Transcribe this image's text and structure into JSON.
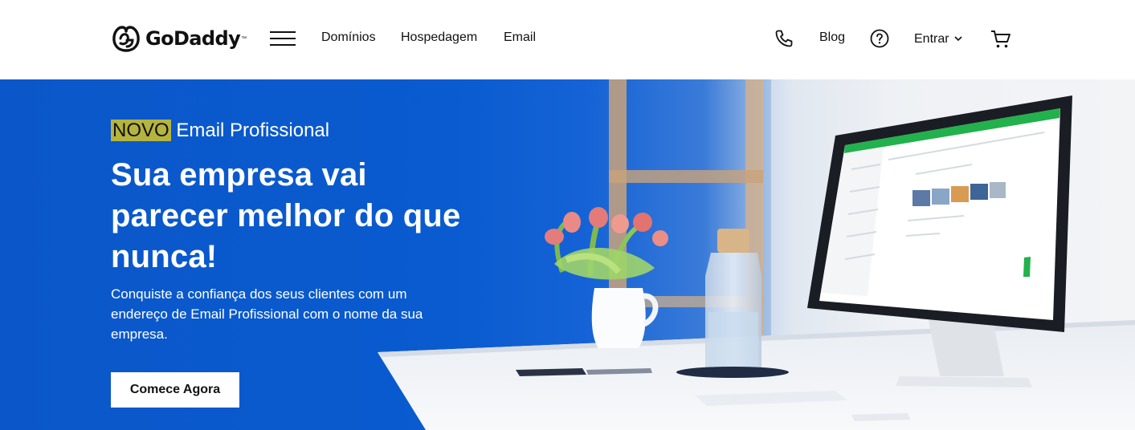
{
  "header": {
    "logo_text": "GoDaddy",
    "logo_tm": "™",
    "nav": [
      "Domínios",
      "Hospedagem",
      "Email"
    ],
    "blog": "Blog",
    "signin": "Entrar",
    "icons": [
      "logo-icon",
      "menu-icon",
      "phone-icon",
      "help-icon",
      "chevron-down-icon",
      "cart-icon"
    ]
  },
  "hero": {
    "badge": "NOVO",
    "eyebrow": "Email Profissional",
    "headline": "Sua empresa vai parecer melhor do que nunca!",
    "subtext": "Conquiste a confiança dos seus clientes com um endereço de Email Profissional com o nome da sua empresa.",
    "cta": "Comece Agora"
  },
  "colors": {
    "hero_blue": "#0a5bd0",
    "badge": "#b5b43e",
    "accent_green": "#1db954"
  }
}
